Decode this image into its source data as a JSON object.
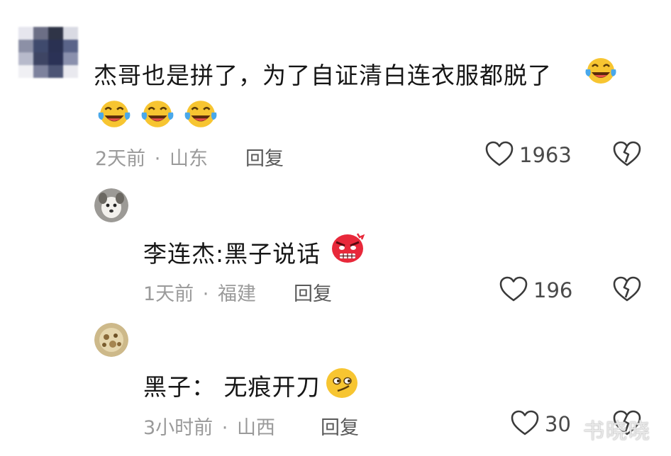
{
  "comments": [
    {
      "text": "杰哥也是拼了，为了自证清白连衣服都脱了",
      "emoji_after": [
        "laughing-tears-emoji",
        "laughing-tears-emoji",
        "laughing-tears-emoji",
        "laughing-tears-emoji"
      ],
      "time": "2天前",
      "sep": "·",
      "location": "山东",
      "reply_label": "回复",
      "likes": "1963"
    },
    {
      "text": "李连杰:黑子说话",
      "emoji_after": [
        "angry-face-emoji"
      ],
      "time": "1天前",
      "sep": "·",
      "location": "福建",
      "reply_label": "回复",
      "likes": "196"
    },
    {
      "text": "黑子： 无痕开刀",
      "emoji_after": [
        "smirk-face-emoji"
      ],
      "time": "3小时前",
      "sep": "·",
      "location": "山西",
      "reply_label": "回复",
      "likes": "30"
    }
  ],
  "watermark": "书晓晓",
  "colors": {
    "emoji_yellow": "#f7c531",
    "angry_red": "#e8283a",
    "meta_gray": "#9a9a9a"
  }
}
